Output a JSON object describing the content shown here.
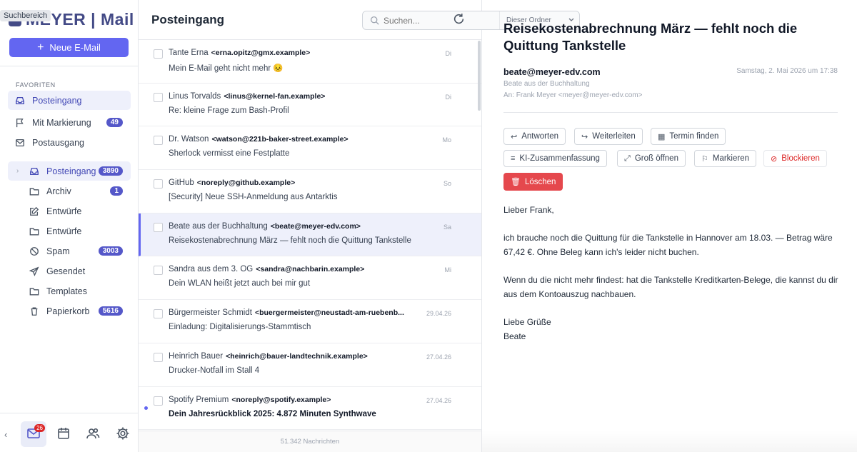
{
  "tooltip": "Suchbereich",
  "app": {
    "logo": "MEYER | Mail"
  },
  "compose": {
    "label": "Neue E-Mail"
  },
  "sidebar": {
    "favorites_label": "FAVORITEN",
    "favorites": [
      {
        "label": "Posteingang",
        "icon": "inbox-icon"
      },
      {
        "label": "Mit Markierung",
        "icon": "flag-icon",
        "badge": "49"
      },
      {
        "label": "Postausgang",
        "icon": "outbox-icon"
      }
    ],
    "folders": [
      {
        "label": "Posteingang",
        "icon": "inbox-icon",
        "badge": "3890"
      },
      {
        "label": "Archiv",
        "icon": "folder-icon",
        "badge": "1"
      },
      {
        "label": "Entwürfe",
        "icon": "edit-icon"
      },
      {
        "label": "Entwürfe",
        "icon": "folder-icon"
      },
      {
        "label": "Spam",
        "icon": "ban-icon",
        "badge": "3003"
      },
      {
        "label": "Gesendet",
        "icon": "send-icon"
      },
      {
        "label": "Templates",
        "icon": "folder-icon"
      },
      {
        "label": "Papierkorb",
        "icon": "trash-icon",
        "badge": "5616"
      }
    ],
    "bottom": {
      "mail_badge": "26"
    }
  },
  "list": {
    "title": "Posteingang",
    "search_placeholder": "Suchen...",
    "scope": "Dieser Ordner",
    "footer": "51.342 Nachrichten",
    "rows": [
      {
        "from": "Tante Erna",
        "addr": "<erna.opitz@gmx.example>",
        "subject": "Mein E-Mail geht nicht mehr 😣",
        "date": "Di"
      },
      {
        "from": "Linus Torvalds",
        "addr": "<linus@kernel-fan.example>",
        "subject": "Re: kleine Frage zum Bash-Profil",
        "date": "Di"
      },
      {
        "from": "Dr. Watson",
        "addr": "<watson@221b-baker-street.example>",
        "subject": "Sherlock vermisst eine Festplatte",
        "date": "Mo"
      },
      {
        "from": "GitHub",
        "addr": "<noreply@github.example>",
        "subject": "[Security] Neue SSH-Anmeldung aus Antarktis",
        "date": "So"
      },
      {
        "from": "Beate aus der Buchhaltung",
        "addr": "<beate@meyer-edv.com>",
        "subject": "Reisekostenabrechnung März — fehlt noch die Quittung Tankstelle",
        "date": "Sa"
      },
      {
        "from": "Sandra aus dem 3. OG",
        "addr": "<sandra@nachbarin.example>",
        "subject": "Dein WLAN heißt jetzt auch bei mir gut",
        "date": "Mi"
      },
      {
        "from": "Bürgermeister Schmidt",
        "addr": "<buergermeister@neustadt-am-ruebenb...",
        "subject": "Einladung: Digitalisierungs-Stammtisch",
        "date": "29.04.26"
      },
      {
        "from": "Heinrich Bauer",
        "addr": "<heinrich@bauer-landtechnik.example>",
        "subject": "Drucker-Notfall im Stall 4",
        "date": "27.04.26"
      },
      {
        "from": "Spotify Premium",
        "addr": "<noreply@spotify.example>",
        "subject": "Dein Jahresrückblick 2025: 4.872 Minuten Synthwave",
        "date": "27.04.26"
      }
    ]
  },
  "reader": {
    "subject": "Reisekostenabrechnung März — fehlt noch die Quittung Tankstelle",
    "from_email": "beate@meyer-edv.com",
    "date": "Samstag, 2. Mai 2026 um 17:38",
    "from_name": "Beate aus der Buchhaltung",
    "to": "An: Frank Meyer <meyer@meyer-edv.com>",
    "actions": {
      "reply": "Antworten",
      "forward": "Weiterleiten",
      "schedule": "Termin finden",
      "summary": "KI-Zusammenfassung",
      "open_large": "Groß öffnen",
      "flag": "Markieren",
      "block": "Blockieren",
      "delete": "Löschen"
    },
    "body": [
      "Lieber Frank,",
      "ich brauche noch die Quittung für die Tankstelle in Hannover am 18.03. — Betrag wäre 67,42 €. Ohne Beleg kann ich's leider nicht buchen.",
      "Wenn du die nicht mehr findest: hat die Tankstelle Kreditkarten-Belege, die kannst du dir aus dem Kontoauszug nachbauen.",
      "Liebe Grüße\nBeate"
    ]
  },
  "colors": {
    "accent": "#6366f1",
    "brand": "#434a86",
    "danger": "#e5484d"
  }
}
